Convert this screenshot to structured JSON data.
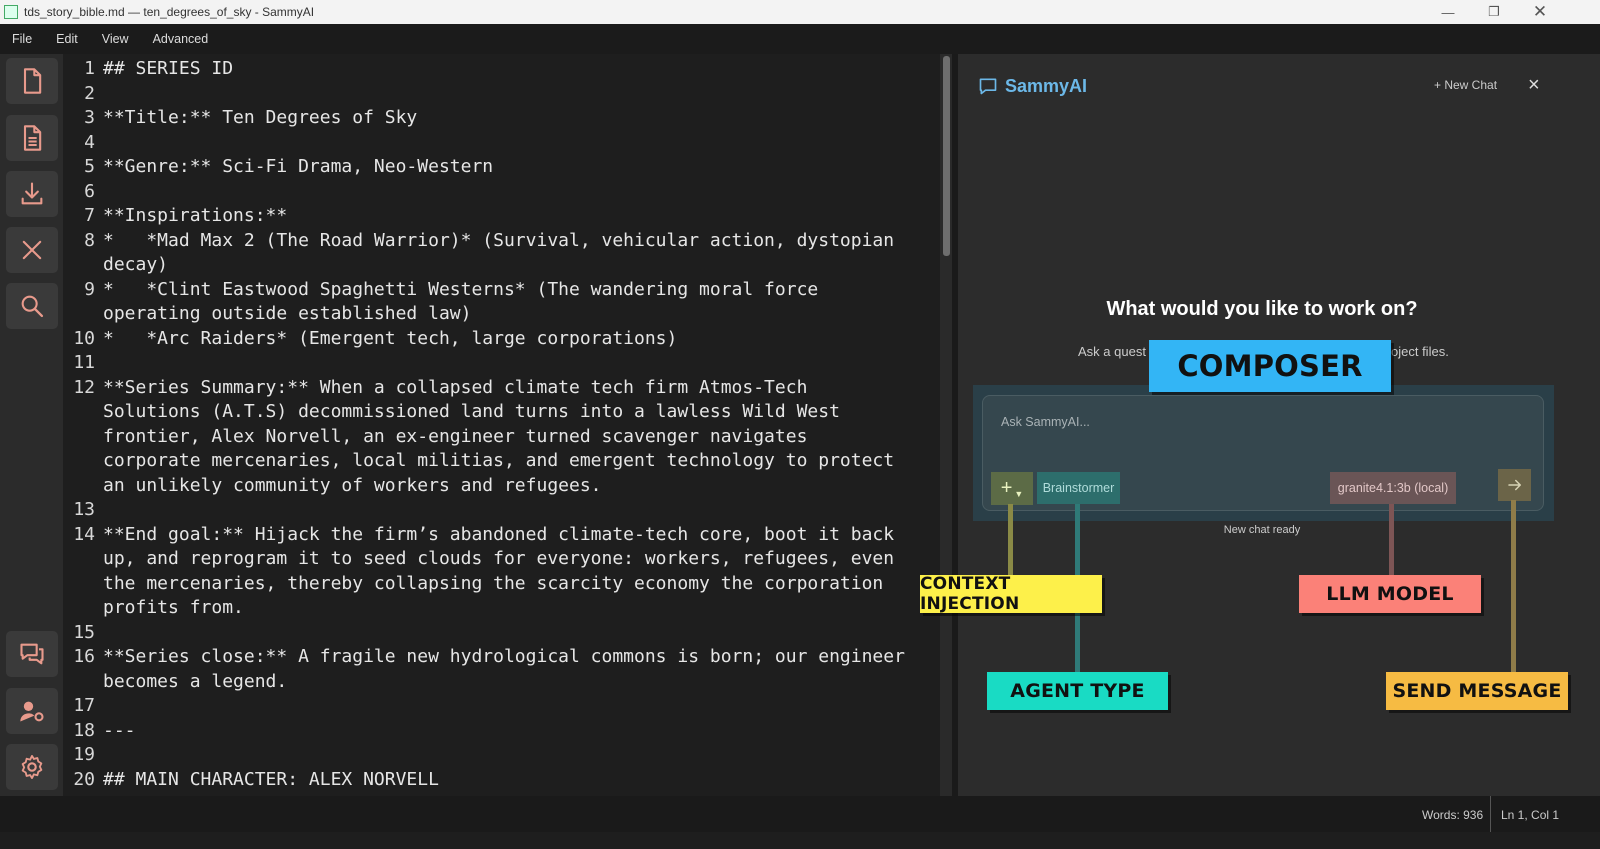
{
  "window": {
    "title": "tds_story_bible.md — ten_degrees_of_sky - SammyAI"
  },
  "menu": [
    "File",
    "Edit",
    "View",
    "Advanced"
  ],
  "sidebar_icons": [
    "new-file-icon",
    "document-icon",
    "download-icon",
    "close-icon",
    "search-icon",
    "chat-icon",
    "user-settings-icon",
    "gear-icon"
  ],
  "editor": {
    "lines": [
      {
        "n": "1",
        "t": [
          "## SERIES ID"
        ]
      },
      {
        "n": "2",
        "t": [
          ""
        ]
      },
      {
        "n": "3",
        "t": [
          "**Title:** Ten Degrees of Sky"
        ]
      },
      {
        "n": "4",
        "t": [
          ""
        ]
      },
      {
        "n": "5",
        "t": [
          "**Genre:** Sci-Fi Drama, Neo-Western"
        ]
      },
      {
        "n": "6",
        "t": [
          ""
        ]
      },
      {
        "n": "7",
        "t": [
          "**Inspirations:**"
        ]
      },
      {
        "n": "8",
        "t": [
          "*   *Mad Max 2 (The Road Warrior)* (Survival, vehicular action, dystopian",
          "decay)"
        ]
      },
      {
        "n": "9",
        "t": [
          "*   *Clint Eastwood Spaghetti Westerns* (The wandering moral force",
          "operating outside established law)"
        ]
      },
      {
        "n": "10",
        "t": [
          "*   *Arc Raiders* (Emergent tech, large corporations)"
        ]
      },
      {
        "n": "11",
        "t": [
          ""
        ]
      },
      {
        "n": "12",
        "t": [
          "**Series Summary:** When a collapsed climate tech firm Atmos-Tech",
          "Solutions (A.T.S) decommissioned land turns into a lawless Wild West",
          "frontier, Alex Norvell, an ex-engineer turned scavenger navigates",
          "corporate mercenaries, local militias, and emergent technology to protect",
          "an unlikely community of workers and refugees."
        ]
      },
      {
        "n": "13",
        "t": [
          ""
        ]
      },
      {
        "n": "14",
        "t": [
          "**End goal:** Hijack the firm’s abandoned climate-tech core, boot it back",
          "up, and reprogram it to seed clouds for everyone: workers, refugees, even",
          "the mercenaries, thereby collapsing the scarcity economy the corporation",
          "profits from."
        ]
      },
      {
        "n": "15",
        "t": [
          ""
        ]
      },
      {
        "n": "16",
        "t": [
          "**Series close:** A fragile new hydrological commons is born; our engineer",
          "becomes a legend."
        ]
      },
      {
        "n": "17",
        "t": [
          ""
        ]
      },
      {
        "n": "18",
        "t": [
          "---"
        ]
      },
      {
        "n": "19",
        "t": [
          ""
        ]
      },
      {
        "n": "20",
        "t": [
          "## MAIN CHARACTER: ALEX NORVELL"
        ]
      }
    ]
  },
  "chat": {
    "title": "SammyAI",
    "new_chat": "+ New Chat",
    "close": "×",
    "heading": "What would you like to work on?",
    "sub_left": "Ask a quest",
    "sub_right": "oject files.",
    "input_placeholder": "Ask SammyAI...",
    "add_button": "+",
    "agent": "Brainstormer",
    "model": "granite4.1:3b (local)",
    "status": "New chat ready"
  },
  "annotations": {
    "composer": "COMPOSER",
    "context": "CONTEXT INJECTION",
    "agent": "AGENT TYPE",
    "llm": "LLM MODEL",
    "send": "SEND MESSAGE"
  },
  "status_bar": {
    "words": "Words: 936",
    "position": "Ln 1, Col 1"
  },
  "colors": {
    "composer_label": "#33b5f5",
    "context_label": "#fdf04a",
    "agent_label": "#19dbc4",
    "llm_label": "#fb8178",
    "send_label": "#f6bb43",
    "accent_blue": "#6cb8e8",
    "sidebar_icon": "#e89a8c"
  }
}
